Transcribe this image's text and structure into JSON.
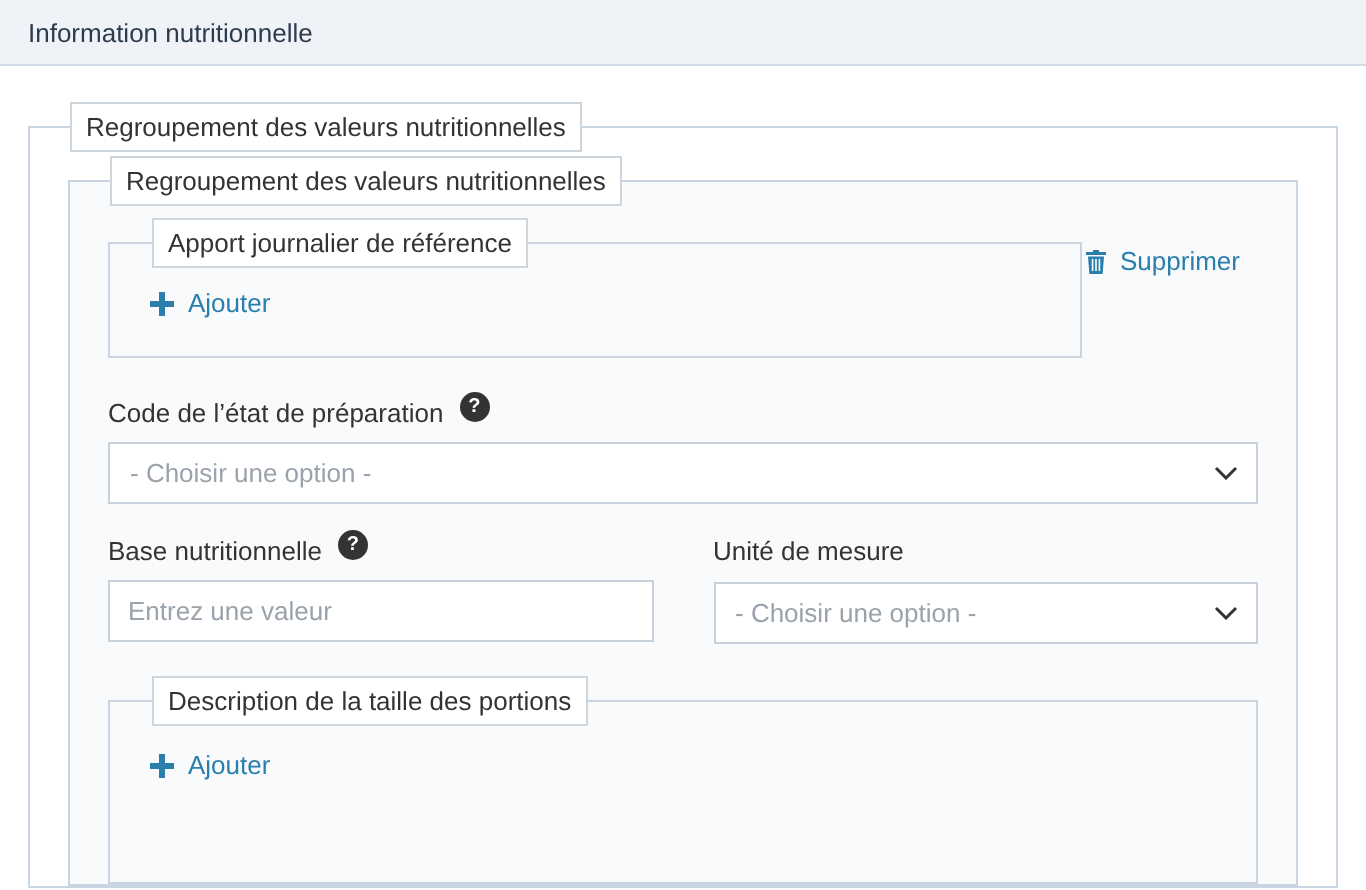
{
  "header": {
    "title": "Information nutritionnelle"
  },
  "group": {
    "legend": "Regroupement des valeurs nutritionnelles",
    "inner_group": {
      "legend": "Regroupement des valeurs nutritionnelles",
      "reference_intake": {
        "legend": "Apport journalier de référence",
        "add_label": "Ajouter"
      },
      "delete_label": "Supprimer",
      "preparation_state": {
        "label": "Code de l’état de préparation",
        "help": "?",
        "placeholder": "- Choisir une option -"
      },
      "nutritional_basis": {
        "label": "Base nutritionnelle",
        "help": "?",
        "placeholder": "Entrez une valeur"
      },
      "unit": {
        "label": "Unité de mesure",
        "placeholder": "- Choisir une option -"
      },
      "serving_size": {
        "legend": "Description de la taille des portions",
        "add_label": "Ajouter"
      }
    }
  }
}
